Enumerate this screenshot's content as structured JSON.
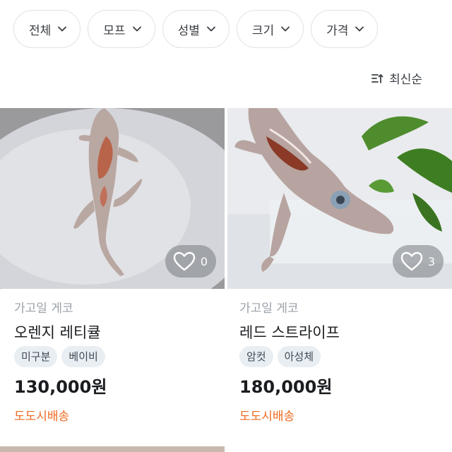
{
  "filters": [
    {
      "label": "전체"
    },
    {
      "label": "모프"
    },
    {
      "label": "성별"
    },
    {
      "label": "크기"
    },
    {
      "label": "가격"
    }
  ],
  "sort": {
    "label": "최신순",
    "icon": "sort-icon"
  },
  "products": [
    {
      "category": "가고일 게코",
      "name": "오렌지 레티큘",
      "tags": [
        "미구분",
        "베이비"
      ],
      "price": "130,000원",
      "shipping": "도도시배송",
      "likes": "0",
      "image": "gecko-on-plate-photo"
    },
    {
      "category": "가고일 게코",
      "name": "레드 스트라이프",
      "tags": [
        "암컷",
        "아성체"
      ],
      "price": "180,000원",
      "shipping": "도도시배송",
      "likes": "3",
      "image": "gecko-with-plant-photo"
    }
  ],
  "colors": {
    "shipping": "#ef6a1f",
    "category": "#9aa1a9",
    "tag_bg": "#e8eef2",
    "chip_border": "#dfe2e6"
  }
}
